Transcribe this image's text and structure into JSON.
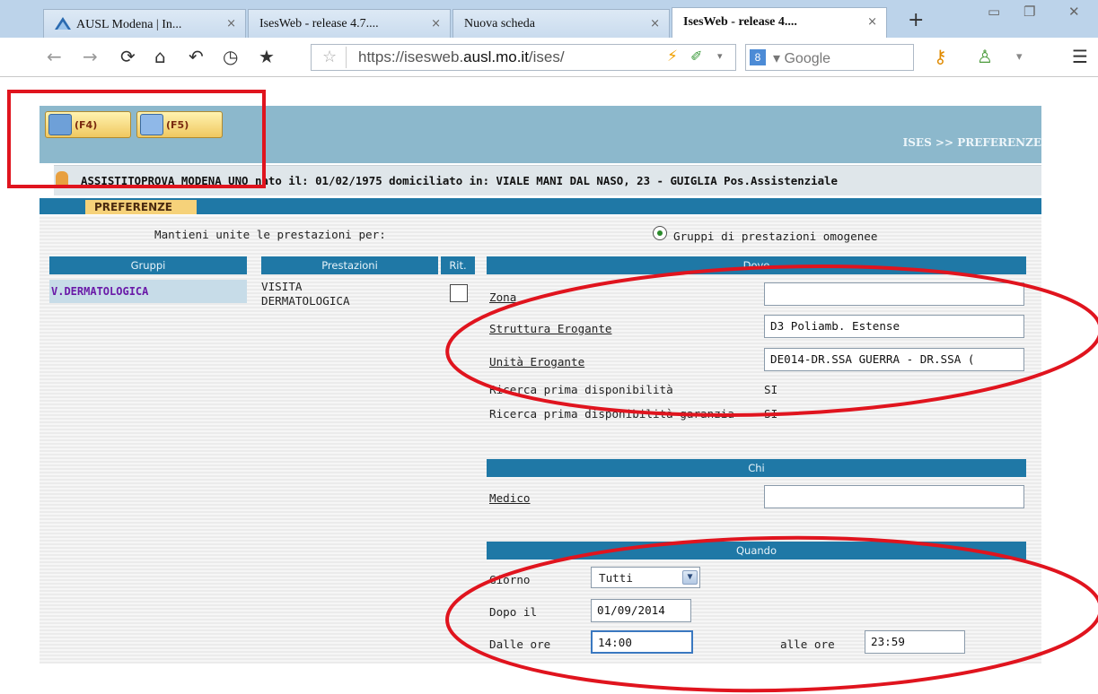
{
  "browser": {
    "tabs": [
      {
        "label": "AUSL Modena | In...",
        "close": "×"
      },
      {
        "label": "IsesWeb - release 4.7....",
        "close": "×"
      },
      {
        "label": "Nuova scheda",
        "close": "×"
      },
      {
        "label": "IsesWeb - release 4....",
        "close": "×"
      }
    ],
    "new_tab": "+",
    "url_host_prefix": "https://isesweb.",
    "url_host_bold": "ausl.mo.it",
    "url_path": "/ises/",
    "search_engine_badge": "8",
    "search_placeholder": "Google"
  },
  "toolbar": {
    "f4_label": "(F4)",
    "f5_label": "(F5)",
    "breadcrumb": "ISES >> PREFERENZE"
  },
  "patient": {
    "text": "ASSISTITOPROVA MODENA UNO  nato il: 01/02/1975  domiciliato in: VIALE MANI DAL NASO, 23 - GUIGLIA Pos.Assistenziale"
  },
  "section": {
    "tab_label": "PREFERENZE"
  },
  "keep_together": {
    "label": "Mantieni unite le prestazioni per:",
    "option": "Gruppi di prestazioni omogenee"
  },
  "table": {
    "headers": {
      "gruppi": "Gruppi",
      "prestazioni": "Prestazioni",
      "rit": "Rit."
    },
    "group_name": "V.DERMATOLOGICA",
    "prestazione_line1": "VISITA",
    "prestazione_line2": "DERMATOLOGICA"
  },
  "dove": {
    "header": "Dove",
    "zona_label": "Zona",
    "zona_value": "",
    "struttura_label": "Struttura Erogante",
    "struttura_value": "D3 Poliamb. Estense",
    "unita_label": "Unità Erogante",
    "unita_value": "DE014-DR.SSA GUERRA - DR.SSA (",
    "prima_label": "Ricerca prima disponibilità",
    "prima_value": "SI",
    "garanzia_label": "Ricerca prima disponibilità garanzia",
    "garanzia_value": "SI"
  },
  "chi": {
    "header": "Chi",
    "medico_label": "Medico",
    "medico_value": ""
  },
  "quando": {
    "header": "Quando",
    "giorno_label": "Giorno",
    "giorno_value": "Tutti",
    "dopo_label": "Dopo il",
    "dopo_value": "01/09/2014",
    "dalle_label": "Dalle ore",
    "dalle_value": "14:00",
    "alle_label": "alle ore",
    "alle_value": "23:59"
  },
  "colors": {
    "header_blue": "#1f78a6",
    "band_blue": "#8cb8cc",
    "annotation_red": "#e0141e",
    "group_purple": "#6a1aa8"
  }
}
